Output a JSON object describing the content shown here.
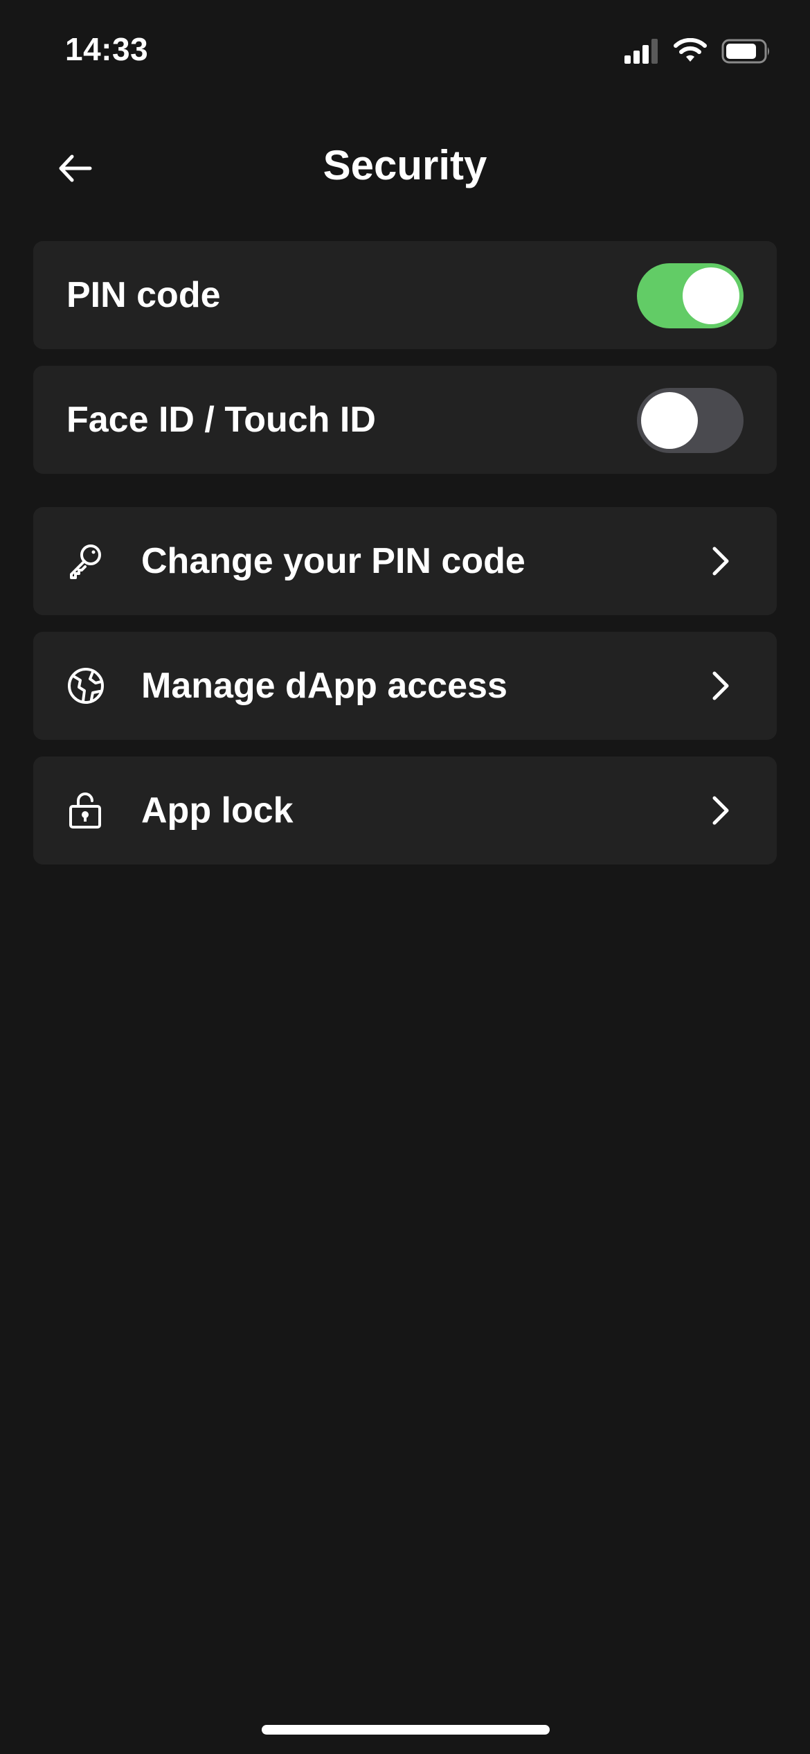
{
  "status_bar": {
    "time": "14:33",
    "icons": [
      "cellular-signal-icon",
      "wifi-icon",
      "battery-icon"
    ]
  },
  "header": {
    "title": "Security",
    "back_icon": "arrow-left-icon"
  },
  "toggles": [
    {
      "label": "PIN code",
      "enabled": true
    },
    {
      "label": "Face ID / Touch ID",
      "enabled": false
    }
  ],
  "menu_items": [
    {
      "label": "Change your PIN code",
      "icon": "key-icon"
    },
    {
      "label": "Manage dApp access",
      "icon": "globe-icon"
    },
    {
      "label": "App lock",
      "icon": "lock-open-icon"
    }
  ],
  "colors": {
    "background": "#161616",
    "card": "#222222",
    "toggle_on": "#62cc66",
    "toggle_off": "#4a4a4f",
    "text": "#ffffff"
  }
}
